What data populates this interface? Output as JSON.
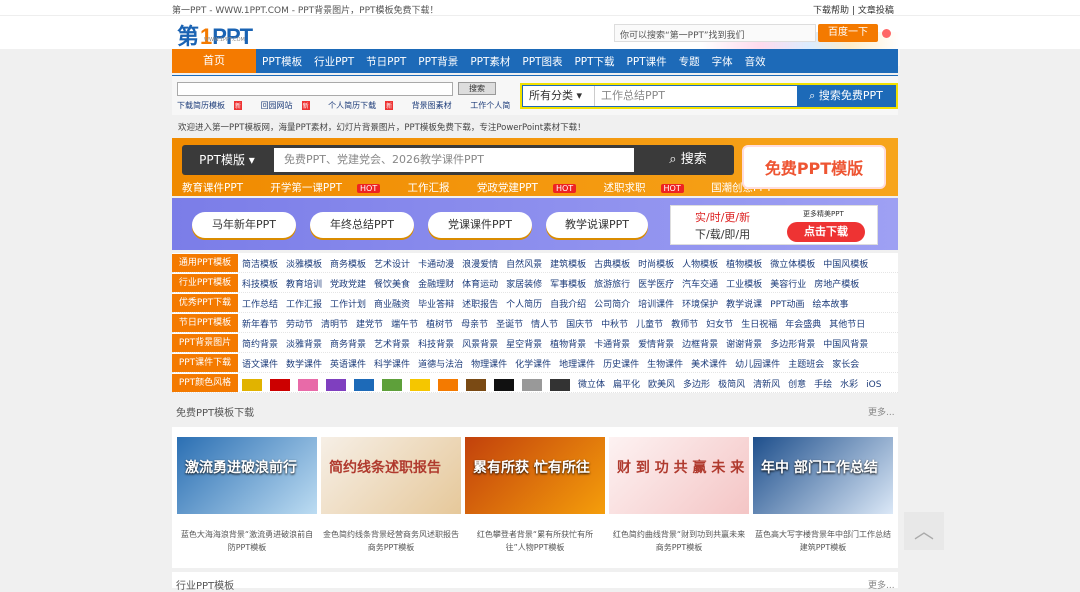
{
  "topbar": {
    "site_text": "第一PPT - WWW.1PPT.COM - PPT背景图片，PPT模板免费下载！",
    "help": "下载帮助",
    "sep": "|",
    "submit": "文章投稿"
  },
  "logo": {
    "p1": "第",
    "p2": "1",
    "p3": "PPT",
    "sub": "WWW.1PPT.COM"
  },
  "header_search": {
    "placeholder": "你可以搜索“第一PPT”找到我们",
    "button": "百度一下"
  },
  "nav": {
    "home": "首页",
    "items": [
      "PPT模板",
      "行业PPT",
      "节日PPT",
      "PPT背景",
      "PPT素材",
      "PPT图表",
      "PPT下载",
      "PPT课件",
      "专题",
      "字体",
      "音效"
    ]
  },
  "small_search": {
    "button": "搜索",
    "links": [
      "下载简历模板",
      "回园网站",
      "个人简历下载",
      "背景图素材",
      "工作个人简"
    ],
    "badge": "新"
  },
  "cat_search": {
    "category": "所有分类",
    "placeholder": "工作总结PPT",
    "button": "搜索免费PPT"
  },
  "welcome": "欢迎进入第一PPT模板网，海量PPT素材，幻灯片背景图片，PPT模板免费下载，专注PowerPoint素材下载！",
  "banner1": {
    "category": "PPT模版",
    "placeholder": "免费PPT、党建党会、2026教学课件PPT",
    "search": "搜索",
    "free": "免费PPT模版",
    "tags": [
      {
        "t": "教育课件PPT",
        "hot": ""
      },
      {
        "t": "开学第一课PPT",
        "hot": "HOT"
      },
      {
        "t": "工作汇报",
        "hot": ""
      },
      {
        "t": "党政党建PPT",
        "hot": "HOT"
      },
      {
        "t": "述职求职",
        "hot": "HOT"
      },
      {
        "t": "国潮创意PPT",
        "hot": ""
      }
    ]
  },
  "banner2": {
    "pills": [
      "马年新年PPT",
      "年终总结PPT",
      "党课课件PPT",
      "教学说课PPT"
    ],
    "ad_t1": "实/时/更/新",
    "ad_t2": "下/载/即/用",
    "ad_more": "更多精美PPT",
    "ad_btn": "点击下载"
  },
  "categories": [
    {
      "label": "通用PPT模板",
      "links": [
        "简洁模板",
        "淡雅模板",
        "商务模板",
        "艺术设计",
        "卡通动漫",
        "浪漫爱情",
        "自然风景",
        "建筑模板",
        "古典模板",
        "时尚模板",
        "人物模板",
        "植物模板",
        "微立体模板",
        "中国风模板"
      ]
    },
    {
      "label": "行业PPT模板",
      "links": [
        "科技模板",
        "教育培训",
        "党政党建",
        "餐饮美食",
        "金融理财",
        "体育运动",
        "家居装修",
        "军事模板",
        "旅游旅行",
        "医学医疗",
        "汽车交通",
        "工业模板",
        "美容行业",
        "房地产模板"
      ]
    },
    {
      "label": "优秀PPT下载",
      "links": [
        "工作总结",
        "工作汇报",
        "工作计划",
        "商业融资",
        "毕业答辩",
        "述职报告",
        "个人简历",
        "自我介绍",
        "公司简介",
        "培训课件",
        "环境保护",
        "教学说课",
        "PPT动画",
        "绘本故事"
      ]
    },
    {
      "label": "节日PPT模板",
      "links": [
        "新年春节",
        "劳动节",
        "清明节",
        "建党节",
        "端午节",
        "植树节",
        "母亲节",
        "圣诞节",
        "情人节",
        "国庆节",
        "中秋节",
        "儿童节",
        "教师节",
        "妇女节",
        "生日祝福",
        "年会盛典",
        "其他节日"
      ]
    },
    {
      "label": "PPT背景图片",
      "links": [
        "简约背景",
        "淡雅背景",
        "商务背景",
        "艺术背景",
        "科技背景",
        "风景背景",
        "星空背景",
        "植物背景",
        "卡通背景",
        "爱情背景",
        "边框背景",
        "谢谢背景",
        "多边形背景",
        "中国风背景"
      ]
    },
    {
      "label": "PPT课件下载",
      "links": [
        "语文课件",
        "数学课件",
        "英语课件",
        "科学课件",
        "道德与法治",
        "物理课件",
        "化学课件",
        "地理课件",
        "历史课件",
        "生物课件",
        "美术课件",
        "幼儿园课件",
        "主题班会",
        "家长会"
      ]
    },
    {
      "label": "PPT颜色风格",
      "colors": [
        "#e1b300",
        "#cc0000",
        "#e86aa8",
        "#7f3fbf",
        "#1d6ab8",
        "#5ea03a",
        "#f5c600",
        "#f47a00",
        "#7a4a14",
        "#111111",
        "#999999",
        "#333333"
      ],
      "links": [
        "微立体",
        "扁平化",
        "欧美风",
        "多边形",
        "极简风",
        "清新风",
        "创意",
        "手绘",
        "水彩",
        "iOS"
      ]
    }
  ],
  "free_section": {
    "title": "免费PPT模板下载",
    "more": "更多..."
  },
  "cards": [
    {
      "thumb_text": "激流勇进破浪前行",
      "bg1": "#2b6fb3",
      "bg2": "#bcdcf2",
      "caption": "蓝色大海海浪背景“激流勇进破浪前自防PPT模板"
    },
    {
      "thumb_text": "简约线条述职报告",
      "bg1": "#f6efe6",
      "bg2": "#e6c89a",
      "caption": "金色简约线条背景经营商务风述职报告商务PPT模板"
    },
    {
      "thumb_text": "累有所获 忙有所往",
      "bg1": "#c2410c",
      "bg2": "#f59e0b",
      "caption": "红色攀登者背景“累有所获忙有所往”人物PPT模板"
    },
    {
      "thumb_text": "财 到 功 共 赢 未 来",
      "bg1": "#fdf2f2",
      "bg2": "#f4c5c5",
      "caption": "红色简约曲线背景“财到功到共赢未来商务PPT模板"
    },
    {
      "thumb_text": "年中 部门工作总结",
      "bg1": "#1e4f8c",
      "bg2": "#dbe8f7",
      "caption": "蓝色高大写字楼背景年中部门工作总结建筑PPT模板"
    }
  ],
  "industry_section": {
    "title": "行业PPT模板",
    "more": "更多..."
  }
}
